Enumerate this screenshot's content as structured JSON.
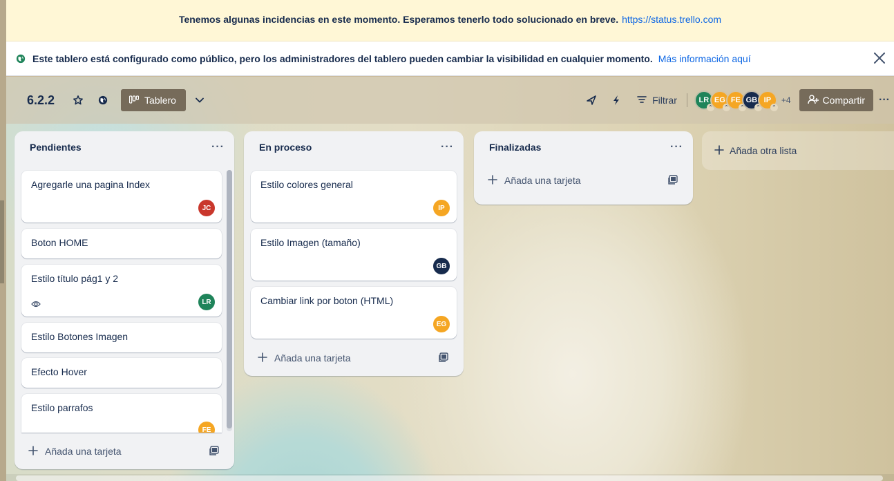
{
  "alert": {
    "message": "Tenemos algunas incidencias en este momento. Esperamos tenerlo todo solucionado en breve.",
    "link": "https://status.trello.com"
  },
  "public_banner": {
    "message": "Este tablero está configurado como público, pero los administradores del tablero pueden cambiar la visibilidad en cualquier momento.",
    "link": "Más información aquí"
  },
  "board": {
    "title": "6.2.2",
    "view_label": "Tablero",
    "filter_label": "Filtrar",
    "share_label": "Compartir",
    "more_members": "+4",
    "members": [
      {
        "initials": "LR",
        "color": "#1f845a"
      },
      {
        "initials": "EG",
        "color": "#f5a623"
      },
      {
        "initials": "FE",
        "color": "#f5a623"
      },
      {
        "initials": "GB",
        "color": "#172b4d"
      },
      {
        "initials": "IP",
        "color": "#f5a623"
      }
    ],
    "add_list_label": "Añada otra lista"
  },
  "lists": [
    {
      "title": "Pendientes",
      "add_card_label": "Añada una tarjeta",
      "cards": [
        {
          "title": "Agregarle una pagina Index",
          "member": "JC",
          "member_color": "#c9372c"
        },
        {
          "title": "Boton HOME"
        },
        {
          "title": "Estilo título pág1 y 2",
          "member": "LR",
          "member_color": "#1f845a",
          "watch": true
        },
        {
          "title": "Estilo Botones Imagen"
        },
        {
          "title": "Efecto Hover"
        },
        {
          "title": "Estilo parrafos",
          "member": "FE",
          "member_color": "#f5a623"
        }
      ]
    },
    {
      "title": "En proceso",
      "add_card_label": "Añada una tarjeta",
      "cards": [
        {
          "title": "Estilo colores general",
          "member": "IP",
          "member_color": "#f5a623"
        },
        {
          "title": "Estilo Imagen (tamaño)",
          "member": "GB",
          "member_color": "#172b4d"
        },
        {
          "title": "Cambiar link por boton (HTML)",
          "member": "EG",
          "member_color": "#f5a623"
        }
      ]
    },
    {
      "title": "Finalizadas",
      "add_card_label": "Añada una tarjeta",
      "cards": []
    }
  ]
}
